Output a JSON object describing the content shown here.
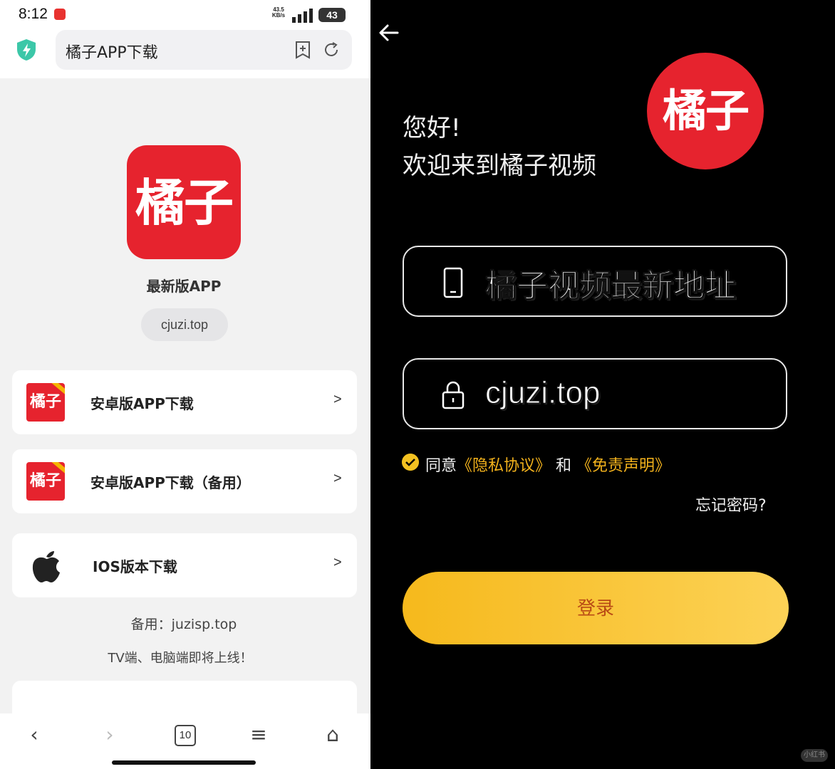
{
  "left": {
    "status": {
      "time": "8:12",
      "net_speed_top": "43.5",
      "net_speed_bottom": "KB/s",
      "battery": "43"
    },
    "address_bar": {
      "url_text": "橘子APP下载"
    },
    "app": {
      "logo_text": "橘子",
      "title": "最新版APP",
      "domain": "cjuzi.top"
    },
    "downloads": [
      {
        "icon": "juzi-logo-icon",
        "label": "安卓版APP下载",
        "chevron": ">"
      },
      {
        "icon": "juzi-logo-icon",
        "label": "安卓版APP下载（备用）",
        "chevron": ">"
      },
      {
        "icon": "apple-icon",
        "label": "IOS版本下载",
        "chevron": ">"
      }
    ],
    "thumb_text": "橘子",
    "backup_text": "备用：juzisp.top",
    "notice_text": "TV端、电脑端即将上线！",
    "navbar": {
      "back": "‹",
      "forward": "›",
      "tabs_count": "10",
      "menu": "≡",
      "home": "⌂"
    }
  },
  "right": {
    "greeting_line1": "您好!",
    "greeting_line2": "欢迎来到橘子视频",
    "logo_text": "橘子",
    "phone_field_value": "橘子视频最新地址",
    "password_field_value": "cjuzi.top",
    "agree": {
      "prefix": "同意",
      "privacy": "《隐私协议》",
      "and": "和",
      "disclaimer": "《免责声明》"
    },
    "forgot_password": "忘记密码?",
    "login_button": "登录",
    "watermark": "小红书"
  },
  "colors": {
    "brand_red": "#e6232e",
    "accent_yellow": "#f3c121",
    "link_orange": "#f3b21c"
  }
}
